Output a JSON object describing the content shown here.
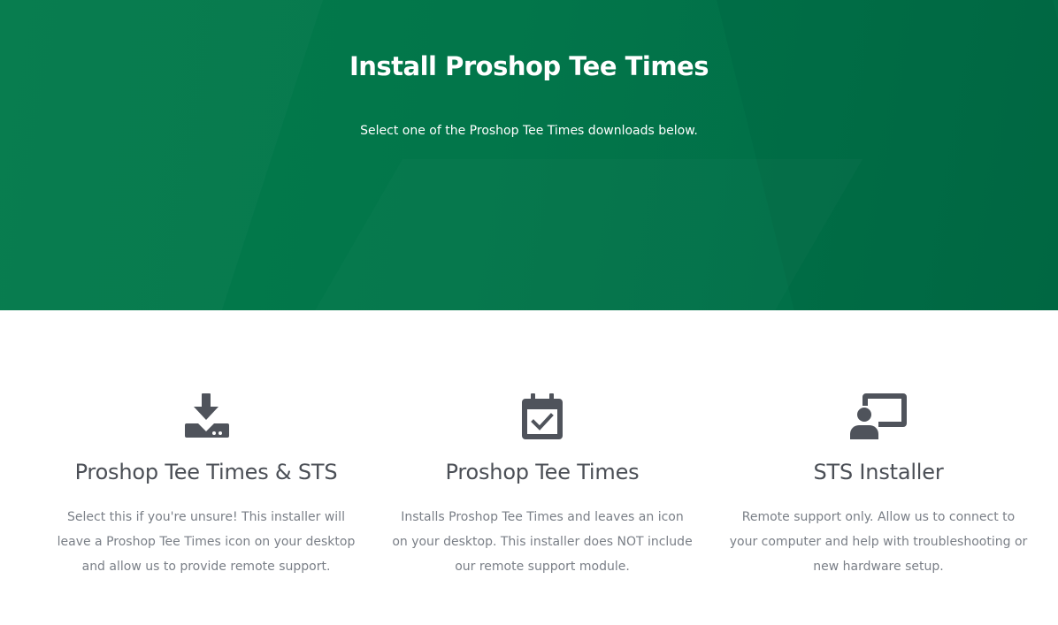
{
  "hero": {
    "title": "Install Proshop Tee Times",
    "subtitle": "Select one of the Proshop Tee Times downloads below.",
    "background_color": "#027449"
  },
  "downloads": [
    {
      "icon": "download-icon",
      "title": "Proshop Tee Times & STS",
      "description": "Select this if you're unsure! This installer will leave a Proshop Tee Times icon on your desktop and allow us to provide remote support."
    },
    {
      "icon": "calendar-check-icon",
      "title": "Proshop Tee Times",
      "description": "Installs Proshop Tee Times and leaves an icon on your desktop. This installer does NOT include our remote support module."
    },
    {
      "icon": "remote-support-icon",
      "title": "STS Installer",
      "description": "Remote support only. Allow us to connect to your computer and help with troubleshooting or new hardware setup."
    }
  ],
  "colors": {
    "icon": "#4f535b",
    "title_text": "#4b4f56",
    "body_text": "#7a7f87"
  }
}
